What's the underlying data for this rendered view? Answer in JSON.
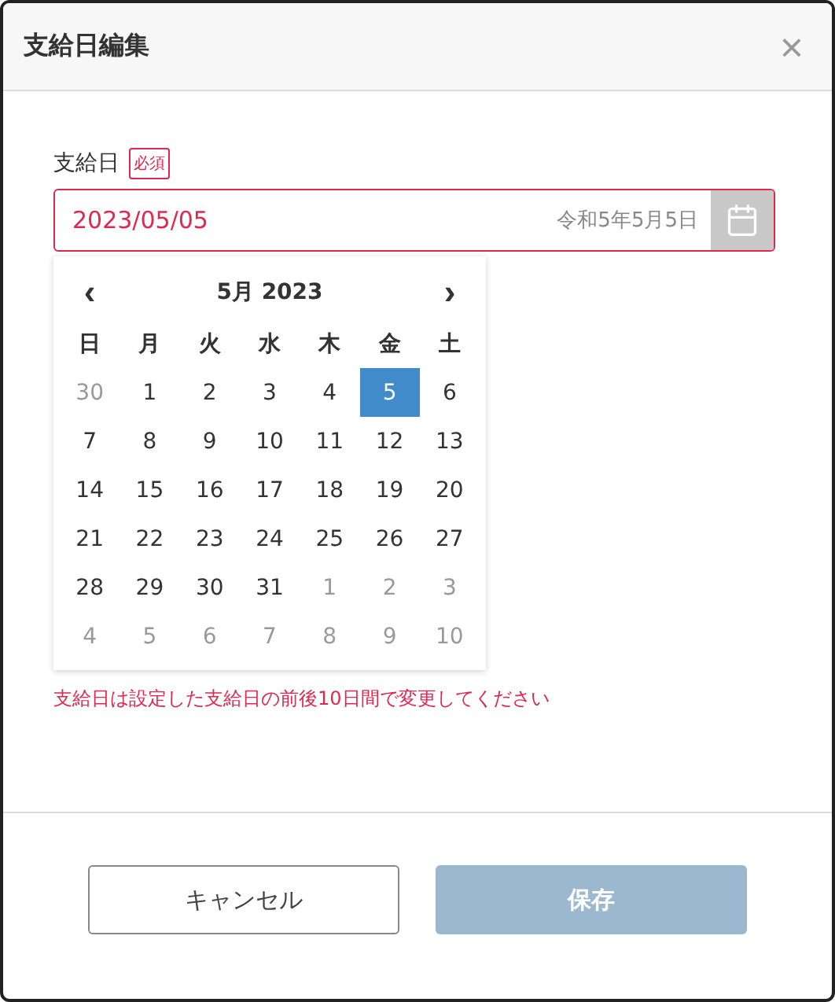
{
  "dialog": {
    "title": "支給日編集",
    "close": "×"
  },
  "field": {
    "label": "支給日",
    "required": "必須",
    "value": "2023/05/05",
    "era_date": "令和5年5月5日",
    "invalid": true
  },
  "calendar": {
    "prev": "‹",
    "next": "›",
    "month": "5月 2023",
    "weekdays": [
      "日",
      "月",
      "火",
      "水",
      "木",
      "金",
      "土"
    ],
    "weeks": [
      [
        {
          "label": "30",
          "outside": true,
          "selected": false
        },
        {
          "label": "1",
          "outside": false,
          "selected": false
        },
        {
          "label": "2",
          "outside": false,
          "selected": false
        },
        {
          "label": "3",
          "outside": false,
          "selected": false
        },
        {
          "label": "4",
          "outside": false,
          "selected": false
        },
        {
          "label": "5",
          "outside": false,
          "selected": true
        },
        {
          "label": "6",
          "outside": false,
          "selected": false
        }
      ],
      [
        {
          "label": "7",
          "outside": false,
          "selected": false
        },
        {
          "label": "8",
          "outside": false,
          "selected": false
        },
        {
          "label": "9",
          "outside": false,
          "selected": false
        },
        {
          "label": "10",
          "outside": false,
          "selected": false
        },
        {
          "label": "11",
          "outside": false,
          "selected": false
        },
        {
          "label": "12",
          "outside": false,
          "selected": false
        },
        {
          "label": "13",
          "outside": false,
          "selected": false
        }
      ],
      [
        {
          "label": "14",
          "outside": false,
          "selected": false
        },
        {
          "label": "15",
          "outside": false,
          "selected": false
        },
        {
          "label": "16",
          "outside": false,
          "selected": false
        },
        {
          "label": "17",
          "outside": false,
          "selected": false
        },
        {
          "label": "18",
          "outside": false,
          "selected": false
        },
        {
          "label": "19",
          "outside": false,
          "selected": false
        },
        {
          "label": "20",
          "outside": false,
          "selected": false
        }
      ],
      [
        {
          "label": "21",
          "outside": false,
          "selected": false
        },
        {
          "label": "22",
          "outside": false,
          "selected": false
        },
        {
          "label": "23",
          "outside": false,
          "selected": false
        },
        {
          "label": "24",
          "outside": false,
          "selected": false
        },
        {
          "label": "25",
          "outside": false,
          "selected": false
        },
        {
          "label": "26",
          "outside": false,
          "selected": false
        },
        {
          "label": "27",
          "outside": false,
          "selected": false
        }
      ],
      [
        {
          "label": "28",
          "outside": false,
          "selected": false
        },
        {
          "label": "29",
          "outside": false,
          "selected": false
        },
        {
          "label": "30",
          "outside": false,
          "selected": false
        },
        {
          "label": "31",
          "outside": false,
          "selected": false
        },
        {
          "label": "1",
          "outside": true,
          "selected": false
        },
        {
          "label": "2",
          "outside": true,
          "selected": false
        },
        {
          "label": "3",
          "outside": true,
          "selected": false
        }
      ],
      [
        {
          "label": "4",
          "outside": true,
          "selected": false
        },
        {
          "label": "5",
          "outside": true,
          "selected": false
        },
        {
          "label": "6",
          "outside": true,
          "selected": false
        },
        {
          "label": "7",
          "outside": true,
          "selected": false
        },
        {
          "label": "8",
          "outside": true,
          "selected": false
        },
        {
          "label": "9",
          "outside": true,
          "selected": false
        },
        {
          "label": "10",
          "outside": true,
          "selected": false
        }
      ]
    ]
  },
  "error": "支給日は設定した支給日の前後10日間で変更してください",
  "buttons": [
    {
      "label": "キャンセル",
      "kind": "secondary",
      "disabled": false
    },
    {
      "label": "保存",
      "kind": "primary",
      "disabled": true
    }
  ]
}
